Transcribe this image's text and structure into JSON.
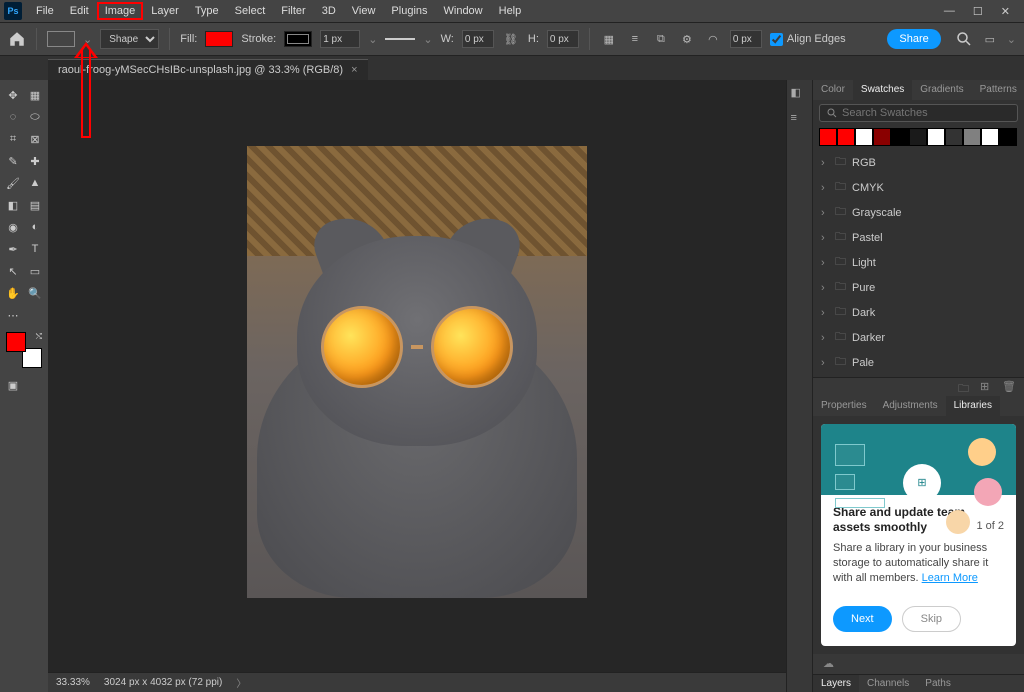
{
  "menu": {
    "items": [
      "File",
      "Edit",
      "Image",
      "Layer",
      "Type",
      "Select",
      "Filter",
      "3D",
      "View",
      "Plugins",
      "Window",
      "Help"
    ],
    "highlight_index": 2,
    "logo": "Ps"
  },
  "options": {
    "shape_mode": "Shape",
    "fill_label": "Fill:",
    "stroke_label": "Stroke:",
    "stroke_width": "1 px",
    "w_label": "W:",
    "w_val": "0 px",
    "h_label": "H:",
    "h_val": "0 px",
    "align_edges": "Align Edges",
    "share": "Share"
  },
  "doc": {
    "tab_title": "raoul-froog-yMSecCHsIBc-unsplash.jpg @ 33.3% (RGB/8)"
  },
  "swatches": {
    "tabs": [
      "Color",
      "Swatches",
      "Gradients",
      "Patterns"
    ],
    "active": 1,
    "search_placeholder": "Search Swatches",
    "row": [
      "#ff0000",
      "#ff0000",
      "#ffffff",
      "#8a0000",
      "#000000",
      "#1a1a1a",
      "#ffffff",
      "#333333",
      "#808080",
      "#ffffff",
      "#000000"
    ],
    "folders": [
      "RGB",
      "CMYK",
      "Grayscale",
      "Pastel",
      "Light",
      "Pure",
      "Dark",
      "Darker",
      "Pale"
    ]
  },
  "panel2": {
    "tabs": [
      "Properties",
      "Adjustments",
      "Libraries"
    ],
    "active": 2
  },
  "lib": {
    "title": "Share and update team assets smoothly",
    "count": "1 of 2",
    "desc": "Share a library in your business storage to automatically share it with all members. ",
    "learn": "Learn More",
    "next": "Next",
    "skip": "Skip"
  },
  "bottom_tabs": [
    "Layers",
    "Channels",
    "Paths"
  ],
  "status": {
    "zoom": "33.33%",
    "dims": "3024 px x 4032 px (72 ppi)"
  }
}
